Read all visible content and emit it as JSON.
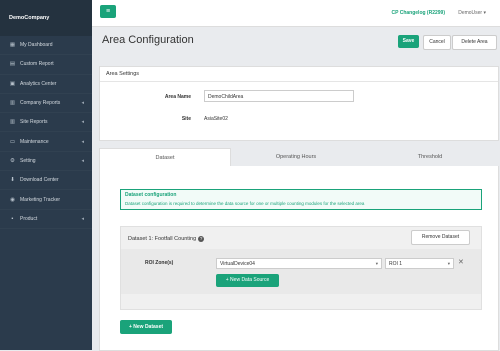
{
  "sidebar": {
    "brand": "DemoCompany",
    "items": [
      {
        "label": "My Dashboard",
        "icon": "dashboard-icon",
        "glyph": "▦",
        "chevron": ""
      },
      {
        "label": "Custom Report",
        "icon": "report-icon",
        "glyph": "▤",
        "chevron": ""
      },
      {
        "label": "Analytics Center",
        "icon": "analytics-icon",
        "glyph": "▣",
        "chevron": ""
      },
      {
        "label": "Company Reports",
        "icon": "chart-icon",
        "glyph": "▥",
        "chevron": "◂"
      },
      {
        "label": "Site Reports",
        "icon": "chart-icon",
        "glyph": "▥",
        "chevron": "◂"
      },
      {
        "label": "Maintenance",
        "icon": "monitor-icon",
        "glyph": "▭",
        "chevron": "◂"
      },
      {
        "label": "Setting",
        "icon": "gear-icon",
        "glyph": "⚙",
        "chevron": "◂"
      },
      {
        "label": "Download Center",
        "icon": "download-icon",
        "glyph": "⬇",
        "chevron": ""
      },
      {
        "label": "Marketing Tracker",
        "icon": "location-icon",
        "glyph": "◉",
        "chevron": ""
      },
      {
        "label": "Product",
        "icon": "box-icon",
        "glyph": "▪",
        "chevron": "◂"
      }
    ]
  },
  "topbar": {
    "menu_glyph": "≡",
    "changelog": "CP Changelog (R2299)",
    "user": "DemoUser ▾"
  },
  "page": {
    "title": "Area Configuration",
    "save": "Save",
    "cancel": "Cancel",
    "delete": "Delete Area"
  },
  "area_settings": {
    "heading": "Area Settings",
    "area_name_label": "Area Name",
    "area_name_value": "DemoChildArea",
    "site_label": "Site",
    "site_value": "AsiaSite02"
  },
  "tabs": [
    "Dataset",
    "Operating Hours",
    "Threshold"
  ],
  "dataset": {
    "alert_title": "Dataset configuration",
    "alert_text": "Dataset configuration is required to determine the data source for one or multiple counting modules for the selected area",
    "title": "Dataset 1: Footfall Counting",
    "help_glyph": "?",
    "remove": "Remove Dataset",
    "roi_label": "ROI Zone(s)",
    "device_value": "VirtualDevice04",
    "roi_value": "ROI 1",
    "caret": "▾",
    "clear_glyph": "✕",
    "add_source": "+ New Data Source",
    "new_dataset": "+ New Dataset"
  },
  "colors": {
    "accent": "#1aa37a",
    "sidebar": "#2b3b4c"
  }
}
